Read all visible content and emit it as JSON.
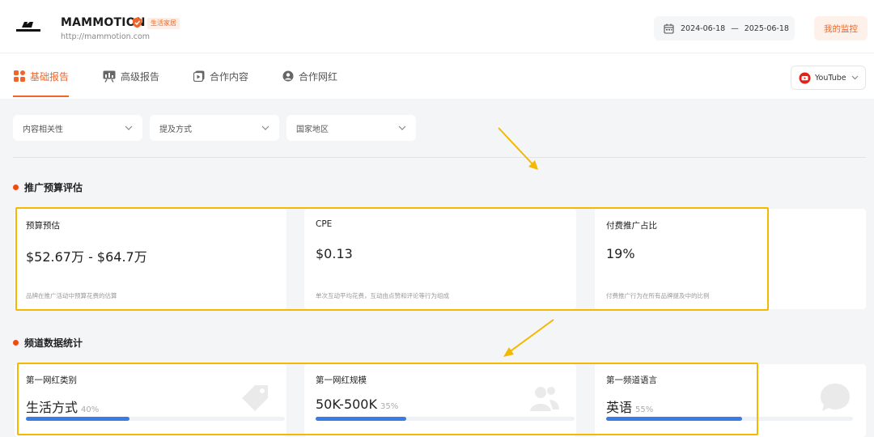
{
  "header": {
    "brand_name": "MAMMOTION",
    "category_badge": "生活家居",
    "brand_url": "http://mammotion.com",
    "date_start": "2024-06-18",
    "date_sep": "—",
    "date_end": "2025-06-18",
    "my_monitor_label": "我的监控"
  },
  "tabs": [
    {
      "label": "基础报告",
      "icon": "grid-icon",
      "active": true
    },
    {
      "label": "高级报告",
      "icon": "report-icon",
      "active": false
    },
    {
      "label": "合作内容",
      "icon": "content-icon",
      "active": false
    },
    {
      "label": "合作网红",
      "icon": "person-icon",
      "active": false
    }
  ],
  "platform": {
    "label": "YouTube",
    "icon": "youtube-icon"
  },
  "filters": [
    {
      "placeholder": "内容相关性"
    },
    {
      "placeholder": "提及方式"
    },
    {
      "placeholder": "国家地区"
    }
  ],
  "budget_section": {
    "title": "推广预算评估",
    "cards": [
      {
        "label": "预算预估",
        "value": "$52.67万 - $64.7万",
        "desc": "品牌在推广活动中预算花费的估算"
      },
      {
        "label": "CPE",
        "value": "$0.13",
        "desc": "单次互动平均花费，互动由点赞和评论等行为组成"
      },
      {
        "label": "付费推广占比",
        "value": "19%",
        "desc": "付费推广行为在所有品牌提及中的比例"
      }
    ]
  },
  "channel_section": {
    "title": "频道数据统计",
    "cards": [
      {
        "label": "第一网红类别",
        "value": "生活方式",
        "pct": "40%",
        "progress": 0.4
      },
      {
        "label": "第一网红规模",
        "value": "50K-500K",
        "pct": "35%",
        "progress": 0.35
      },
      {
        "label": "第一频道语言",
        "value": "英语",
        "pct": "55%",
        "progress": 0.55
      }
    ]
  },
  "colors": {
    "accent": "#f0662a",
    "progress": "#3b7be4",
    "highlight": "#f5b800",
    "section_dot": "#f04a0e"
  }
}
